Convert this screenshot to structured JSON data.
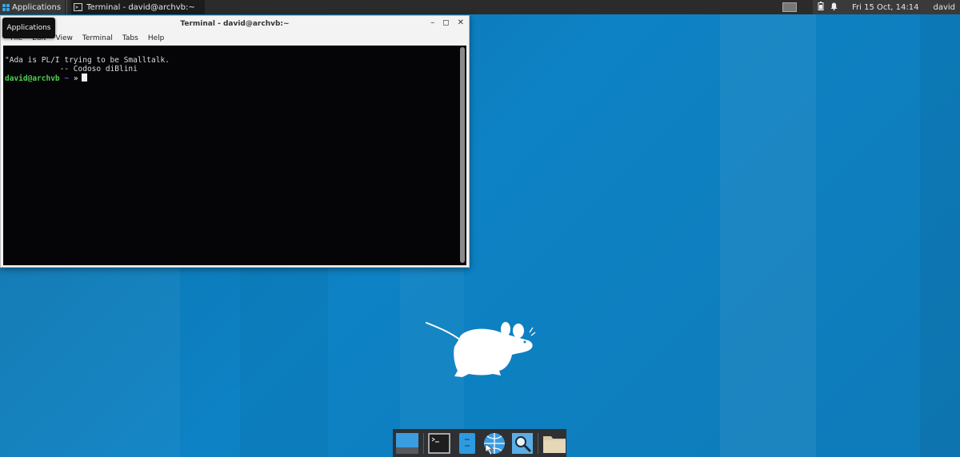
{
  "top_panel": {
    "applications_label": "Applications",
    "task_label": "Terminal - david@archvb:~",
    "clock": "Fri 15 Oct, 14:14",
    "user": "david"
  },
  "tooltip": {
    "text": "Applications"
  },
  "window": {
    "title": "Terminal - david@archvb:~",
    "menu": [
      "File",
      "Edit",
      "View",
      "Terminal",
      "Tabs",
      "Help"
    ],
    "controls": {
      "minimize": "–",
      "maximize": "◻",
      "close": "✕"
    }
  },
  "terminal": {
    "line1": "\"Ada is PL/I trying to be Smalltalk.",
    "line2": "            -- Codoso diBlini",
    "prompt_user": "david@archvb",
    "prompt_dir": "~",
    "prompt_symbol": "»"
  },
  "icons": {
    "apps": "xfce-menu-icon",
    "battery": "battery-icon",
    "notifications": "bell-icon"
  },
  "dock": {
    "items": [
      "show-desktop-icon",
      "terminal-icon",
      "file-manager-icon",
      "web-browser-icon",
      "search-icon",
      "folder-icon"
    ]
  },
  "colors": {
    "desktop": "#0d82c4",
    "panel": "#2b2b2b",
    "terminal_bg": "#050508",
    "prompt_user": "#4fd14f",
    "prompt_dir": "#6a8cff"
  }
}
